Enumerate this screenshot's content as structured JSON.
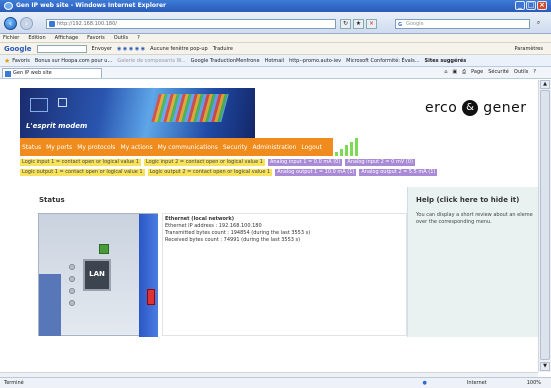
{
  "window": {
    "title": "Gen IP web site - Windows Internet Explorer",
    "min": "_",
    "max": "□",
    "close": "×"
  },
  "address": {
    "url": "http://192.168.100.180/",
    "search_placeholder": "Google"
  },
  "menus": [
    "Fichier",
    "Edition",
    "Affichage",
    "Favoris",
    "Outils",
    "?"
  ],
  "googlebar": {
    "brand": "Google",
    "items": [
      "Envoyer",
      "Aucune fenêtre pop-up",
      "Traduire"
    ],
    "params": "Paramètres"
  },
  "favorites": {
    "label": "Favoris",
    "items": [
      "Bonus sur Hoopa.com pour u...",
      "Galerie de composants W...",
      "Google TraductionMenfrone",
      "Hotmail",
      "http--promo.auto-iev",
      "Microsoft Conformité: Évals...",
      "Sites suggérés"
    ]
  },
  "tab": {
    "label": "Gen IP web site"
  },
  "tools": [
    "Page",
    "Sécurité",
    "Outils"
  ],
  "banner": {
    "tagline": "L'esprit modem",
    "logo_left": "erco",
    "logo_amp": "&",
    "logo_right": "gener"
  },
  "nav": [
    "Status",
    "My ports",
    "My protocols",
    "My actions",
    "My communications",
    "Security",
    "Administration",
    "Logout"
  ],
  "signal_levels": [
    0.2,
    0.4,
    0.6,
    0.8,
    1.0
  ],
  "inputs": [
    {
      "label": "Logic input 1 = contact open or logical value 1",
      "color": "#f7e25a"
    },
    {
      "label": "Logic input 2 = contact open or logical value 1",
      "color": "#f7e25a"
    },
    {
      "label": "Analog input 1 = 0.0 mA (0)",
      "color": "#a98ad6"
    },
    {
      "label": "Analog input 2 = 0 mV (0)",
      "color": "#a98ad6"
    }
  ],
  "outputs": [
    {
      "label": "Logic output 1 = contact open or logical value 1",
      "color": "#f7e25a"
    },
    {
      "label": "Logic output 2 = contact open or logical value 1",
      "color": "#f7e25a"
    },
    {
      "label": "Analog output 1 = 10.0 mA (1)",
      "color": "#a98ad6"
    },
    {
      "label": "Analog output 2 = 5.5 mA (1)",
      "color": "#a98ad6"
    }
  ],
  "status": {
    "heading": "Status",
    "net_title": "Ethernet (local network)",
    "lines": [
      "Ethernet IP address : 192.168.100.180",
      "Transmitted bytes count : 194854 (during the last 3553 s)",
      "Received bytes count : 74991 (during the last 3553 s)"
    ],
    "port_label": "LAN"
  },
  "help": {
    "title": "Help (click here to hide it)",
    "text": "You can display a short review about an eleme\nover the corresponding menu."
  },
  "statusbar": {
    "left": "Terminé",
    "zone": "Internet",
    "zoom": "100%"
  }
}
